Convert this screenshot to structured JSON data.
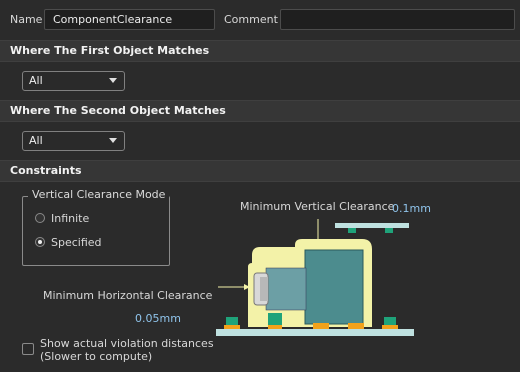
{
  "name": {
    "label": "Name",
    "value": "ComponentClearance"
  },
  "comment": {
    "label": "Comment",
    "value": ""
  },
  "first_match": {
    "title": "Where The First Object Matches",
    "selected": "All"
  },
  "second_match": {
    "title": "Where The Second Object Matches",
    "selected": "All"
  },
  "constraints": {
    "title": "Constraints",
    "mode_group": {
      "title": "Vertical Clearance Mode",
      "options": [
        {
          "label": "Infinite",
          "selected": false
        },
        {
          "label": "Specified",
          "selected": true
        }
      ]
    },
    "min_vertical": {
      "label": "Minimum Vertical Clearance",
      "value": "0.1mm"
    },
    "min_horizontal": {
      "label": "Minimum Horizontal Clearance",
      "value": "0.05mm"
    },
    "show_violations": {
      "label": "Show actual violation distances",
      "sublabel": "(Slower to compute)",
      "checked": false
    }
  },
  "colors": {
    "component_body": "#4c8c8e",
    "clearance_zone": "#f3f2a8",
    "pad_green": "#1fa37a",
    "pad_orange": "#f2a21b",
    "board": "#bfe1e0"
  }
}
